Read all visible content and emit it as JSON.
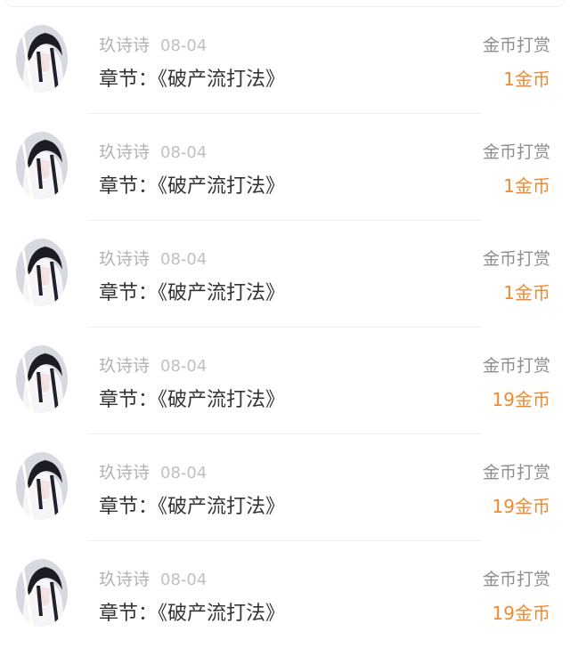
{
  "records": [
    {
      "name": "玖诗诗",
      "date": "08-04",
      "chapter": "章节：《破产流打法》",
      "type": "金币打赏",
      "amount": "1金币",
      "avatar_icon": "anime-character-avatar"
    },
    {
      "name": "玖诗诗",
      "date": "08-04",
      "chapter": "章节：《破产流打法》",
      "type": "金币打赏",
      "amount": "1金币",
      "avatar_icon": "anime-character-avatar"
    },
    {
      "name": "玖诗诗",
      "date": "08-04",
      "chapter": "章节：《破产流打法》",
      "type": "金币打赏",
      "amount": "1金币",
      "avatar_icon": "anime-character-avatar"
    },
    {
      "name": "玖诗诗",
      "date": "08-04",
      "chapter": "章节：《破产流打法》",
      "type": "金币打赏",
      "amount": "19金币",
      "avatar_icon": "anime-character-avatar"
    },
    {
      "name": "玖诗诗",
      "date": "08-04",
      "chapter": "章节：《破产流打法》",
      "type": "金币打赏",
      "amount": "19金币",
      "avatar_icon": "anime-character-avatar"
    },
    {
      "name": "玖诗诗",
      "date": "08-04",
      "chapter": "章节：《破产流打法》",
      "type": "金币打赏",
      "amount": "19金币",
      "avatar_icon": "anime-character-avatar"
    }
  ],
  "colors": {
    "amount": "#f08a2c",
    "name": "#b3b3b3",
    "type": "#8e8e8e",
    "chapter": "#333333"
  }
}
